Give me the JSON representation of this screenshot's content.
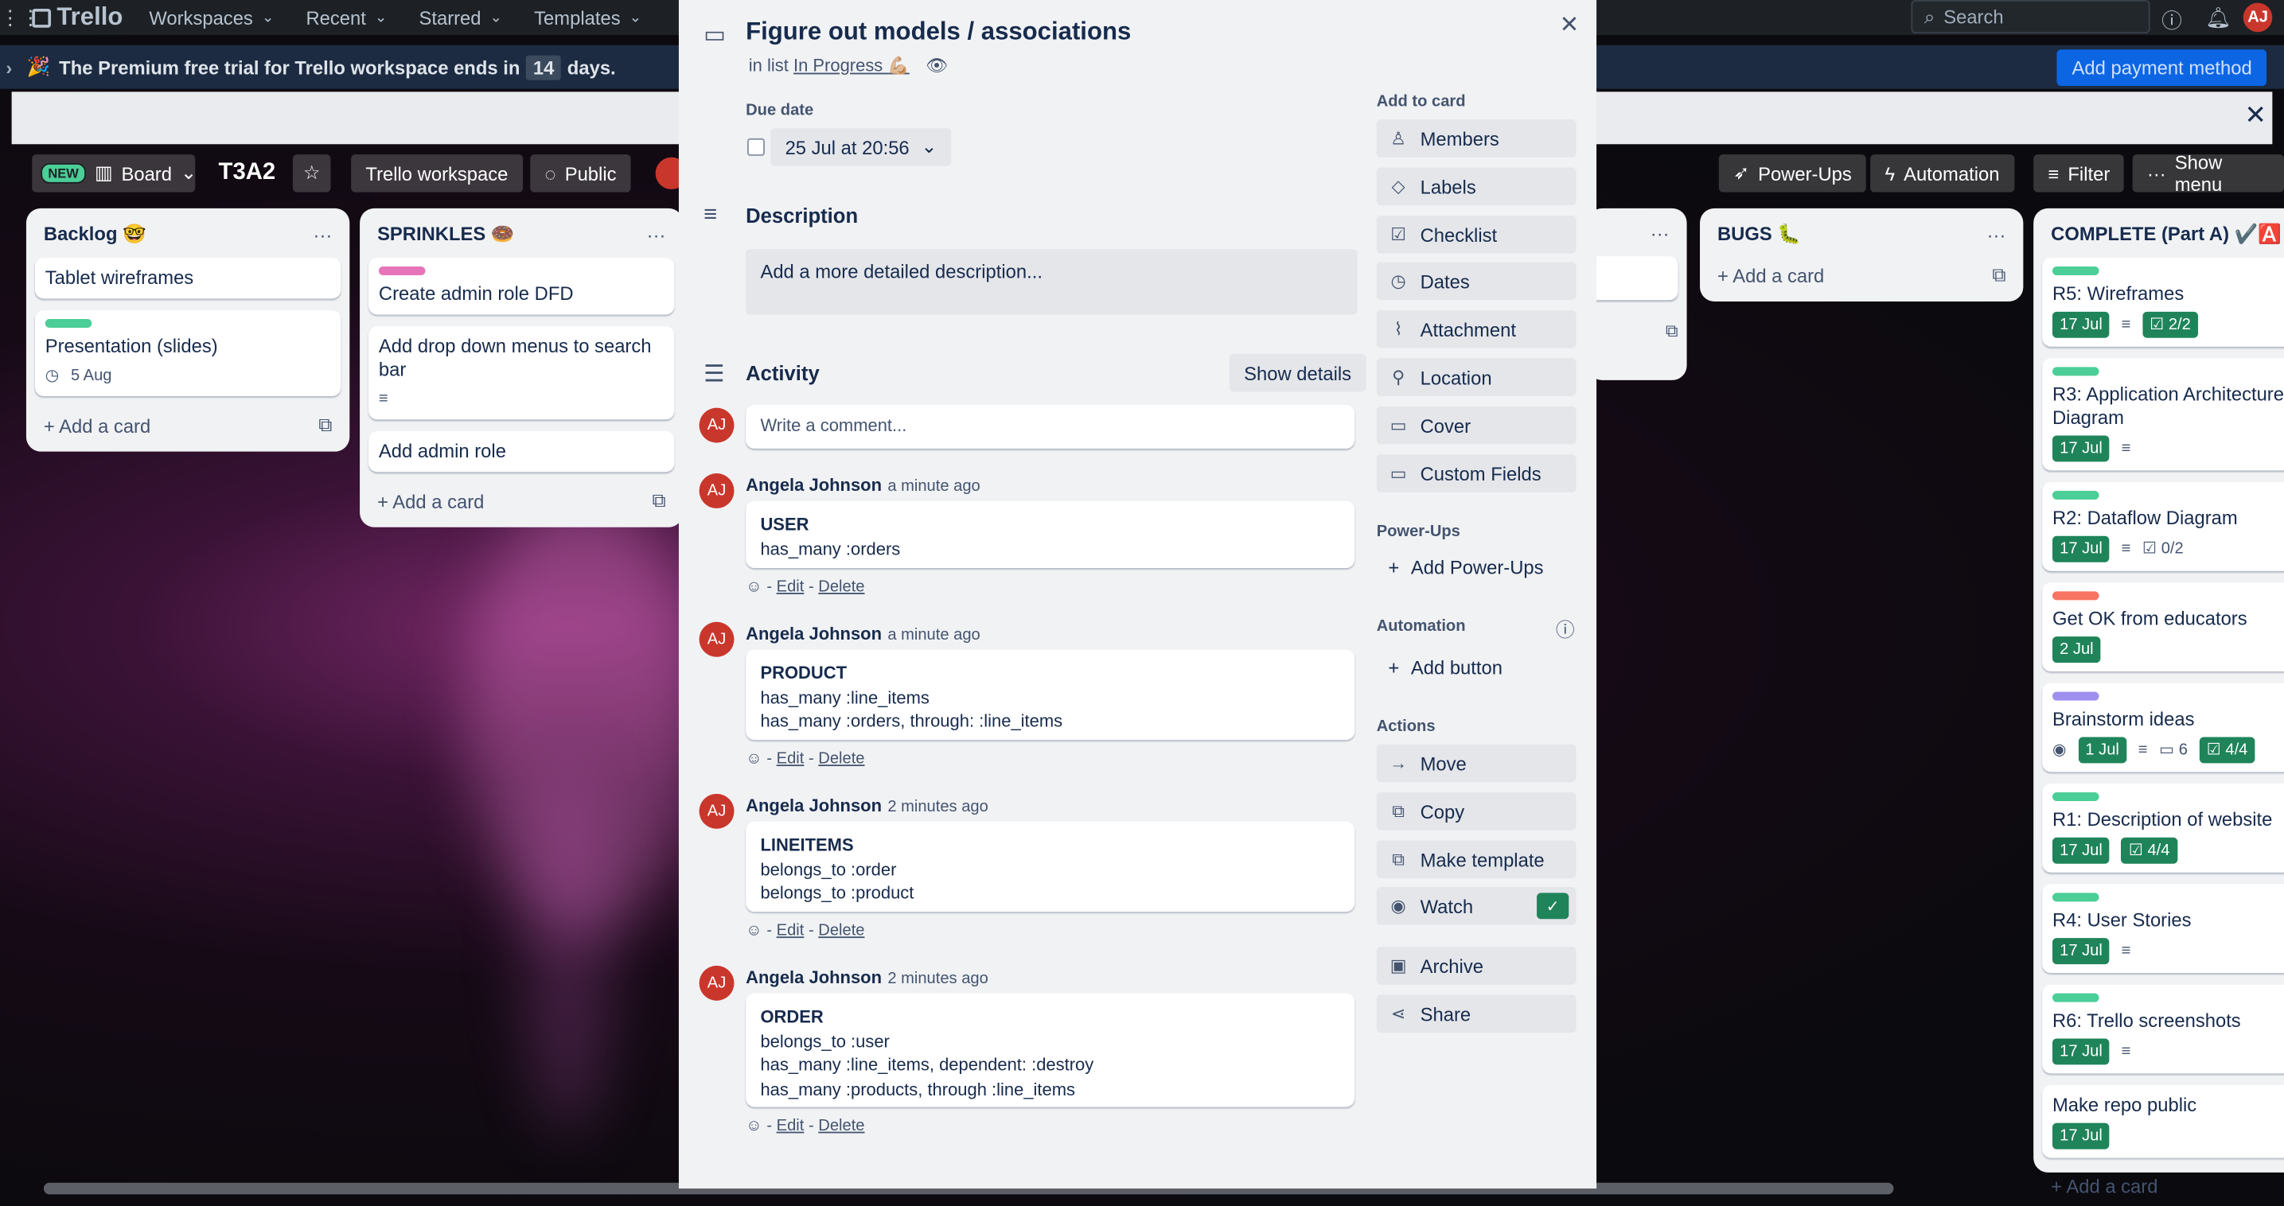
{
  "topnav": {
    "brand": "Trello",
    "items": [
      "Workspaces",
      "Recent",
      "Starred",
      "Templates"
    ],
    "search_placeholder": "Search",
    "avatar": "AJ"
  },
  "banner": {
    "text_pre": "The Premium free trial for Trello workspace ends in",
    "days_num": "14",
    "text_post": "days.",
    "pay_button": "Add payment method"
  },
  "board": {
    "new_tag": "NEW",
    "view": "Board",
    "title": "T3A2",
    "workspace": "Trello workspace",
    "visibility": "Public",
    "powerups": "Power-Ups",
    "automation": "Automation",
    "filter": "Filter",
    "show_menu": "Show menu"
  },
  "lists": {
    "backlog": {
      "title": "Backlog 🤓",
      "cards": [
        {
          "title": "Tablet wireframes"
        },
        {
          "title": "Presentation (slides)",
          "date": "5 Aug"
        }
      ],
      "add": "Add a card"
    },
    "sprinkles": {
      "title": "SPRINKLES 🍩",
      "cards": [
        {
          "title": "Create admin role DFD"
        },
        {
          "title": "Add drop down menus to search bar"
        },
        {
          "title": "Add admin role"
        }
      ],
      "add": "Add a card"
    },
    "bugs": {
      "title": "BUGS 🐛",
      "add": "Add a card"
    },
    "complete": {
      "title": "COMPLETE (Part A) ✔️🅰️",
      "cards": [
        {
          "title": "R5: Wireframes",
          "date": "17 Jul",
          "check": "2/2",
          "label_color": "#4bce97"
        },
        {
          "title": "R3: Application Architecture Diagram",
          "date": "17 Jul",
          "label_color": "#4bce97"
        },
        {
          "title": "R2: Dataflow Diagram",
          "date": "17 Jul",
          "check": "0/2",
          "label_color": "#4bce97"
        },
        {
          "title": "Get OK from educators",
          "date": "2 Jul",
          "label_color": "#f87462"
        },
        {
          "title": "Brainstorm ideas",
          "date": "1 Jul",
          "comments": "6",
          "check": "4/4",
          "label_color": "#9f8fef"
        },
        {
          "title": "R1: Description of website",
          "date": "17 Jul",
          "check": "4/4",
          "label_color": "#4bce97"
        },
        {
          "title": "R4: User Stories",
          "date": "17 Jul",
          "label_color": "#4bce97"
        },
        {
          "title": "R6: Trello screenshots",
          "date": "17 Jul",
          "label_color": "#4bce97"
        },
        {
          "title": "Make repo public",
          "date": "17 Jul"
        }
      ],
      "add": "Add a card"
    }
  },
  "modal": {
    "title": "Figure out models / associations",
    "in_list_prefix": "in list",
    "list_name": "In Progress 💪🏼",
    "due_label": "Due date",
    "due_value": "25 Jul at 20:56",
    "desc_heading": "Description",
    "desc_placeholder": "Add a more detailed description...",
    "activity_heading": "Activity",
    "show_details": "Show details",
    "comment_placeholder": "Write a comment...",
    "comments": [
      {
        "author": "Angela Johnson",
        "time": "a minute ago",
        "heading": "USER",
        "lines": [
          "has_many :orders"
        ]
      },
      {
        "author": "Angela Johnson",
        "time": "a minute ago",
        "heading": "PRODUCT",
        "lines": [
          "has_many :line_items",
          "has_many :orders, through: :line_items"
        ]
      },
      {
        "author": "Angela Johnson",
        "time": "2 minutes ago",
        "heading": "LINEITEMS",
        "lines": [
          "belongs_to :order",
          "belongs_to :product"
        ]
      },
      {
        "author": "Angela Johnson",
        "time": "2 minutes ago",
        "heading": "ORDER",
        "lines": [
          "belongs_to :user",
          "has_many :line_items, dependent: :destroy",
          "has_many :products, through :line_items"
        ]
      }
    ],
    "edit": "Edit",
    "delete": "Delete",
    "dash": "-",
    "sidebar": {
      "add_to_card": "Add to card",
      "add_buttons": [
        "Members",
        "Labels",
        "Checklist",
        "Dates",
        "Attachment",
        "Location",
        "Cover",
        "Custom Fields"
      ],
      "powerups_heading": "Power-Ups",
      "add_powerups": "Add Power-Ups",
      "automation_heading": "Automation",
      "add_button": "Add button",
      "actions_heading": "Actions",
      "actions": [
        "Move",
        "Copy",
        "Make template",
        "Watch",
        "Archive",
        "Share"
      ]
    }
  }
}
